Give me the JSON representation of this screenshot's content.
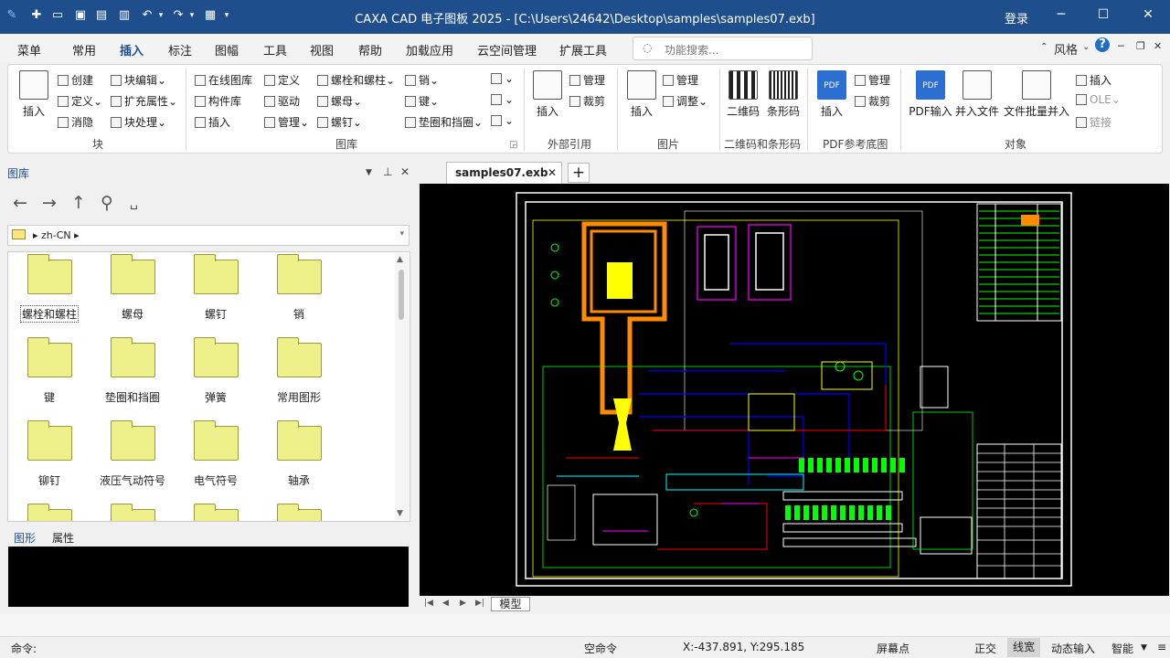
{
  "window": {
    "title": "CAXA CAD 电子图板 2025 - [C:\\Users\\24642\\Desktop\\samples\\samples07.exb]",
    "login": "登录",
    "minimize": "─",
    "maximize": "☐",
    "close": "✕",
    "quick_access": [
      "✚",
      "▭",
      "▣",
      "▤",
      "▥",
      "↶",
      "▾",
      "↷",
      "▾",
      "▦",
      "▾"
    ]
  },
  "menu": {
    "items": [
      "菜单",
      "常用",
      "插入",
      "标注",
      "图幅",
      "工具",
      "视图",
      "帮助",
      "加载应用",
      "云空间管理",
      "扩展工具"
    ],
    "active": "插入",
    "search_placeholder": "功能搜索...",
    "style_label": "风格",
    "help": "?"
  },
  "ribbon": {
    "groups": [
      "块",
      "图库",
      "外部引用",
      "图片",
      "二维码和条形码",
      "PDF参考底图",
      "对象"
    ],
    "block": {
      "insert": "插入",
      "create": "创建",
      "define": "定义",
      "erase": "消隐",
      "block_edit": "块编辑",
      "ext_attr": "扩充属性",
      "block_process": "块处理"
    },
    "library": {
      "online": "在线图库",
      "component": "构件库",
      "insert": "插入",
      "define": "定义",
      "drive": "驱动",
      "manage": "管理",
      "bolt": "螺栓和螺柱",
      "nut": "螺母",
      "screw": "螺钉",
      "pin": "销",
      "key": "键",
      "washer": "垫圈和挡圈"
    },
    "xref": {
      "insert": "插入",
      "manage": "管理",
      "clip": "裁剪"
    },
    "image": {
      "insert": "插入",
      "manage": "管理",
      "adjust": "调整"
    },
    "code": {
      "qr": "二维码",
      "barcode": "条形码"
    },
    "pdf": {
      "insert": "插入",
      "manage": "管理",
      "clip": "裁剪"
    },
    "object": {
      "pdf_input": "PDF输入",
      "merge_file": "并入文件",
      "batch_merge": "文件批量并入",
      "insert": "插入",
      "ole": "OLE",
      "link": "链接"
    }
  },
  "library_panel": {
    "title": "图库",
    "path": "zh-CN",
    "items": [
      "螺栓和螺柱",
      "螺母",
      "螺钉",
      "销",
      "键",
      "垫圈和挡圈",
      "弹簧",
      "常用图形",
      "铆钉",
      "液压气动符号",
      "电气符号",
      "轴承"
    ],
    "tabs": [
      "图形",
      "属性"
    ]
  },
  "document": {
    "tab": "samples07.exb",
    "model_tab": "模型"
  },
  "statusbar": {
    "command_label": "命令:",
    "command_state": "空命令",
    "coords": "X:-437.891, Y:295.185",
    "screen_point": "屏幕点",
    "ortho": "正交",
    "linewidth": "线宽",
    "dynamic_input": "动态输入",
    "smart": "智能"
  }
}
